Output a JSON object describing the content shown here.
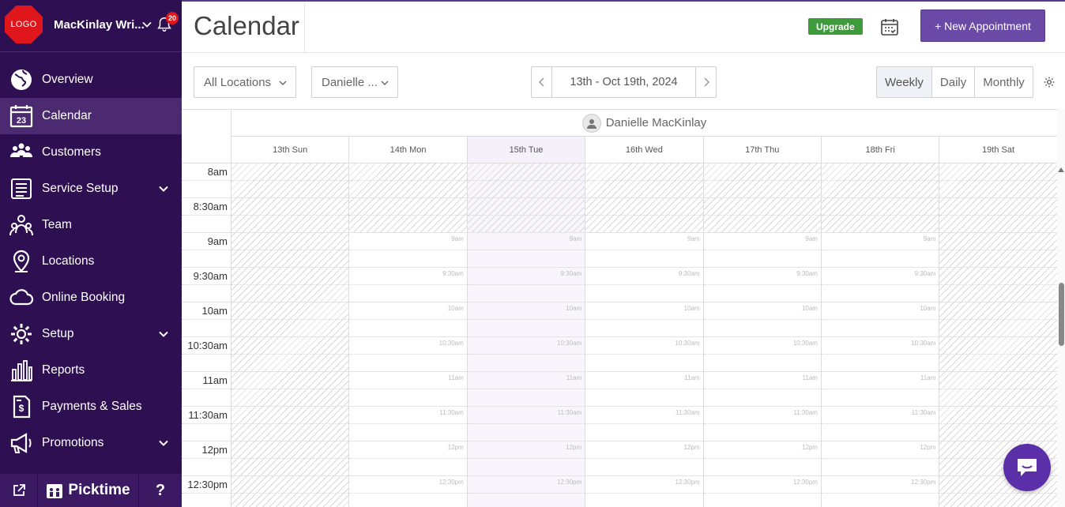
{
  "sidebar": {
    "logo_text": "LOGO",
    "business_name": "MacKinlay Wri...",
    "notification_count": "20",
    "items": [
      {
        "label": "Overview",
        "icon": "globe-icon",
        "active": false,
        "expandable": false
      },
      {
        "label": "Calendar",
        "icon": "calendar-icon",
        "active": true,
        "expandable": false
      },
      {
        "label": "Customers",
        "icon": "customers-icon",
        "active": false,
        "expandable": false
      },
      {
        "label": "Service Setup",
        "icon": "list-icon",
        "active": false,
        "expandable": true
      },
      {
        "label": "Team",
        "icon": "team-icon",
        "active": false,
        "expandable": false
      },
      {
        "label": "Locations",
        "icon": "location-pin-icon",
        "active": false,
        "expandable": false
      },
      {
        "label": "Online Booking",
        "icon": "cloud-icon",
        "active": false,
        "expandable": false
      },
      {
        "label": "Setup",
        "icon": "gear-icon",
        "active": false,
        "expandable": true
      },
      {
        "label": "Reports",
        "icon": "bar-chart-icon",
        "active": false,
        "expandable": false
      },
      {
        "label": "Payments & Sales",
        "icon": "invoice-icon",
        "active": false,
        "expandable": false
      },
      {
        "label": "Promotions",
        "icon": "megaphone-icon",
        "active": false,
        "expandable": true
      }
    ],
    "bottom": {
      "brand": "Picktime",
      "help": "?"
    }
  },
  "header": {
    "title": "Calendar",
    "upgrade_label": "Upgrade",
    "new_appointment_label": "+ New Appointment"
  },
  "toolbar": {
    "location_select": "All Locations",
    "staff_select": "Danielle ...",
    "date_range": "13th - Oct 19th, 2024",
    "views": [
      "Weekly",
      "Daily",
      "Monthly"
    ],
    "active_view": "Weekly"
  },
  "calendar": {
    "staff_name": "Danielle MacKinlay",
    "days": [
      "13th Sun",
      "14th Mon",
      "15th Tue",
      "16th Wed",
      "17th Thu",
      "18th Fri",
      "19th Sat"
    ],
    "today_index": 2,
    "closed_days": [
      0,
      6
    ],
    "times": [
      "8am",
      "8:30am",
      "9am",
      "9:30am",
      "10am",
      "10:30am",
      "11am",
      "11:30am",
      "12pm",
      "12:30pm"
    ],
    "open_from_index": 2
  },
  "colors": {
    "sidebar_bg": "#2e0f52",
    "sidebar_active": "#4b2a72",
    "primary": "#6a4aa6",
    "upgrade_green": "#3f9a3c",
    "badge_red": "#e0161d"
  }
}
